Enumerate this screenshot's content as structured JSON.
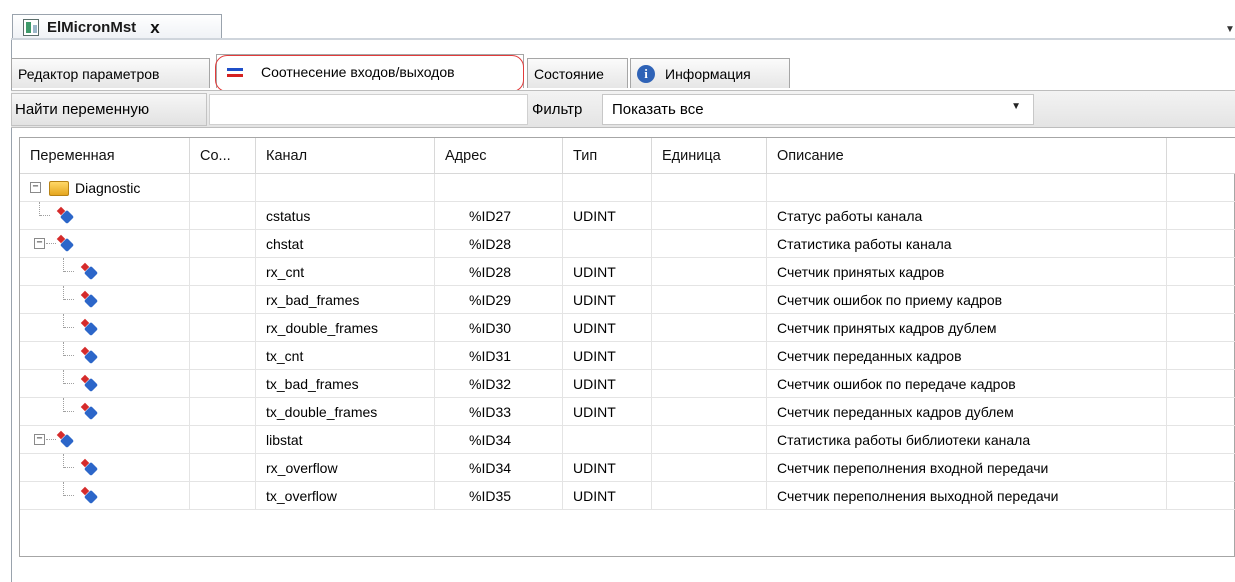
{
  "doc_tab": {
    "title": "ElMicronMst",
    "close": "x"
  },
  "subtabs": [
    {
      "label": "Редактор параметров"
    },
    {
      "label": "Соотнесение входов/выходов"
    },
    {
      "label": "Состояние"
    },
    {
      "label": "Информация"
    }
  ],
  "toolbar": {
    "find_label": "Найти переменную",
    "find_value": "",
    "filter_label": "Фильтр",
    "filter_value": "Показать все"
  },
  "columns": [
    "Переменная",
    "Со...",
    "Канал",
    "Адрес",
    "Тип",
    "Единица",
    "Описание"
  ],
  "rows": [
    {
      "variable": "Diagnostic",
      "channel": "",
      "address": "",
      "type": "",
      "unit": "",
      "description": ""
    },
    {
      "variable": "",
      "channel": "cstatus",
      "address": "%ID27",
      "type": "UDINT",
      "unit": "",
      "description": "Статус работы канала"
    },
    {
      "variable": "",
      "channel": "chstat",
      "address": "%ID28",
      "type": "",
      "unit": "",
      "description": "Статистика работы канала"
    },
    {
      "variable": "",
      "channel": "rx_cnt",
      "address": "%ID28",
      "type": "UDINT",
      "unit": "",
      "description": "Счетчик принятых кадров"
    },
    {
      "variable": "",
      "channel": "rx_bad_frames",
      "address": "%ID29",
      "type": "UDINT",
      "unit": "",
      "description": "Счетчик ошибок по приему кадров"
    },
    {
      "variable": "",
      "channel": "rx_double_frames",
      "address": "%ID30",
      "type": "UDINT",
      "unit": "",
      "description": "Счетчик принятых кадров дублем"
    },
    {
      "variable": "",
      "channel": "tx_cnt",
      "address": "%ID31",
      "type": "UDINT",
      "unit": "",
      "description": "Счетчик переданных кадров"
    },
    {
      "variable": "",
      "channel": "tx_bad_frames",
      "address": "%ID32",
      "type": "UDINT",
      "unit": "",
      "description": "Счетчик ошибок по передаче кадров"
    },
    {
      "variable": "",
      "channel": "tx_double_frames",
      "address": "%ID33",
      "type": "UDINT",
      "unit": "",
      "description": "Счетчик переданных кадров дублем"
    },
    {
      "variable": "",
      "channel": "libstat",
      "address": "%ID34",
      "type": "",
      "unit": "",
      "description": "Статистика работы библиотеки канала"
    },
    {
      "variable": "",
      "channel": "rx_overflow",
      "address": "%ID34",
      "type": "UDINT",
      "unit": "",
      "description": "Счетчик переполнения входной передачи"
    },
    {
      "variable": "",
      "channel": "tx_overflow",
      "address": "%ID35",
      "type": "UDINT",
      "unit": "",
      "description": "Счетчик переполнения выходной передачи"
    }
  ]
}
